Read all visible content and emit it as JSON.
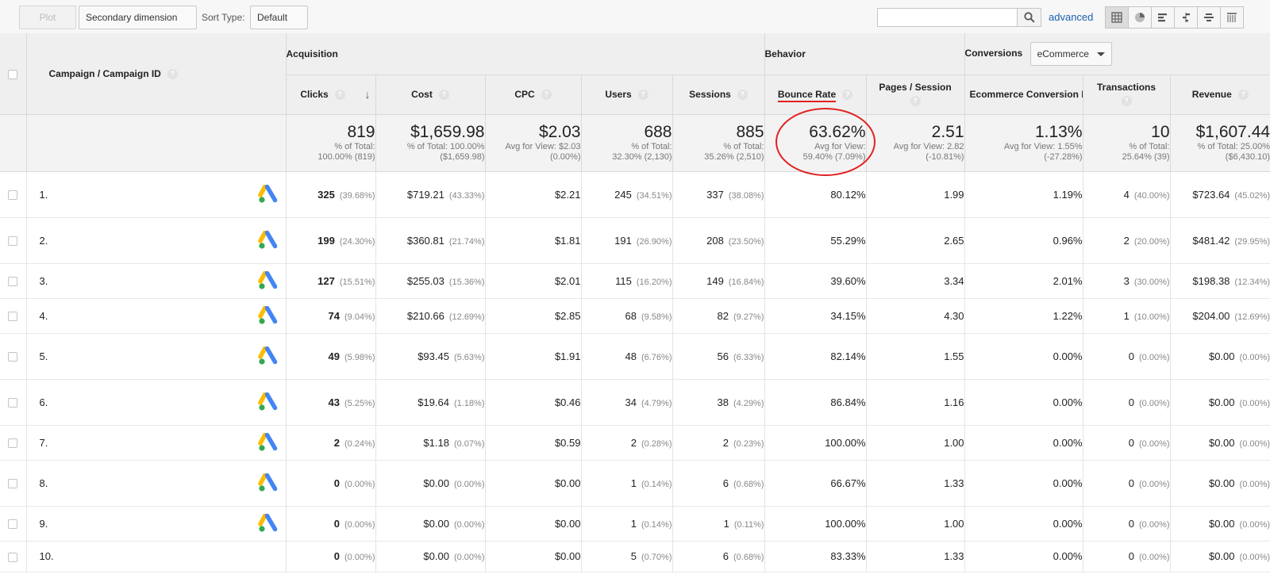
{
  "toolbar": {
    "plot_rows": "Plot Rows",
    "secondary_dimension": "Secondary dimension",
    "sort_type_label": "Sort Type:",
    "sort_type_value": "Default",
    "search_value": "",
    "advanced": "advanced",
    "view_icons": [
      "table-view-icon",
      "pie-view-icon",
      "performance-view-icon",
      "comparison-view-icon",
      "term-cloud-view-icon",
      "pivot-view-icon"
    ]
  },
  "groups": {
    "acquisition": "Acquisition",
    "behavior": "Behavior",
    "conversions": "Conversions",
    "conversions_select": "eCommerce"
  },
  "columns": {
    "dimension": "Campaign / Campaign ID",
    "clicks": "Clicks",
    "cost": "Cost",
    "cpc": "CPC",
    "users": "Users",
    "sessions": "Sessions",
    "bounce_rate": "Bounce Rate",
    "pages_session": "Pages / Session",
    "ecom_rate": "Ecommerce Conversion Rate",
    "transactions": "Transactions",
    "revenue": "Revenue"
  },
  "totals": {
    "clicks": {
      "value": "819",
      "sub1": "% of Total:",
      "sub2": "100.00% (819)"
    },
    "cost": {
      "value": "$1,659.98",
      "sub1": "% of Total: 100.00%",
      "sub2": "($1,659.98)"
    },
    "cpc": {
      "value": "$2.03",
      "sub1": "Avg for View: $2.03",
      "sub2": "(0.00%)"
    },
    "users": {
      "value": "688",
      "sub1": "% of Total:",
      "sub2": "32.30% (2,130)"
    },
    "sessions": {
      "value": "885",
      "sub1": "% of Total:",
      "sub2": "35.26% (2,510)"
    },
    "bounce_rate": {
      "value": "63.62%",
      "sub1": "Avg for View:",
      "sub2": "59.40% (7.09%)"
    },
    "pages_session": {
      "value": "2.51",
      "sub1": "Avg for View: 2.82",
      "sub2": "(-10.81%)"
    },
    "ecom_rate": {
      "value": "1.13%",
      "sub1": "Avg for View: 1.55%",
      "sub2": "(-27.28%)"
    },
    "transactions": {
      "value": "10",
      "sub1": "% of Total:",
      "sub2": "25.64% (39)"
    },
    "revenue": {
      "value": "$1,607.44",
      "sub1": "% of Total: 25.00%",
      "sub2": "($6,430.10)"
    }
  },
  "rows": [
    {
      "idx": "1.",
      "clicks": "325",
      "clicks_pct": "(39.68%)",
      "cost": "$719.21",
      "cost_pct": "(43.33%)",
      "cpc": "$2.21",
      "users": "245",
      "users_pct": "(34.51%)",
      "sessions": "337",
      "sessions_pct": "(38.08%)",
      "bounce": "80.12%",
      "pages": "1.99",
      "ecom": "1.19%",
      "trans": "4",
      "trans_pct": "(40.00%)",
      "revenue": "$723.64",
      "revenue_pct": "(45.02%)"
    },
    {
      "idx": "2.",
      "clicks": "199",
      "clicks_pct": "(24.30%)",
      "cost": "$360.81",
      "cost_pct": "(21.74%)",
      "cpc": "$1.81",
      "users": "191",
      "users_pct": "(26.90%)",
      "sessions": "208",
      "sessions_pct": "(23.50%)",
      "bounce": "55.29%",
      "pages": "2.65",
      "ecom": "0.96%",
      "trans": "2",
      "trans_pct": "(20.00%)",
      "revenue": "$481.42",
      "revenue_pct": "(29.95%)"
    },
    {
      "idx": "3.",
      "clicks": "127",
      "clicks_pct": "(15.51%)",
      "cost": "$255.03",
      "cost_pct": "(15.36%)",
      "cpc": "$2.01",
      "users": "115",
      "users_pct": "(16.20%)",
      "sessions": "149",
      "sessions_pct": "(16.84%)",
      "bounce": "39.60%",
      "pages": "3.34",
      "ecom": "2.01%",
      "trans": "3",
      "trans_pct": "(30.00%)",
      "revenue": "$198.38",
      "revenue_pct": "(12.34%)"
    },
    {
      "idx": "4.",
      "clicks": "74",
      "clicks_pct": "(9.04%)",
      "cost": "$210.66",
      "cost_pct": "(12.69%)",
      "cpc": "$2.85",
      "users": "68",
      "users_pct": "(9.58%)",
      "sessions": "82",
      "sessions_pct": "(9.27%)",
      "bounce": "34.15%",
      "pages": "4.30",
      "ecom": "1.22%",
      "trans": "1",
      "trans_pct": "(10.00%)",
      "revenue": "$204.00",
      "revenue_pct": "(12.69%)"
    },
    {
      "idx": "5.",
      "clicks": "49",
      "clicks_pct": "(5.98%)",
      "cost": "$93.45",
      "cost_pct": "(5.63%)",
      "cpc": "$1.91",
      "users": "48",
      "users_pct": "(6.76%)",
      "sessions": "56",
      "sessions_pct": "(6.33%)",
      "bounce": "82.14%",
      "pages": "1.55",
      "ecom": "0.00%",
      "trans": "0",
      "trans_pct": "(0.00%)",
      "revenue": "$0.00",
      "revenue_pct": "(0.00%)"
    },
    {
      "idx": "6.",
      "clicks": "43",
      "clicks_pct": "(5.25%)",
      "cost": "$19.64",
      "cost_pct": "(1.18%)",
      "cpc": "$0.46",
      "users": "34",
      "users_pct": "(4.79%)",
      "sessions": "38",
      "sessions_pct": "(4.29%)",
      "bounce": "86.84%",
      "pages": "1.16",
      "ecom": "0.00%",
      "trans": "0",
      "trans_pct": "(0.00%)",
      "revenue": "$0.00",
      "revenue_pct": "(0.00%)"
    },
    {
      "idx": "7.",
      "clicks": "2",
      "clicks_pct": "(0.24%)",
      "cost": "$1.18",
      "cost_pct": "(0.07%)",
      "cpc": "$0.59",
      "users": "2",
      "users_pct": "(0.28%)",
      "sessions": "2",
      "sessions_pct": "(0.23%)",
      "bounce": "100.00%",
      "pages": "1.00",
      "ecom": "0.00%",
      "trans": "0",
      "trans_pct": "(0.00%)",
      "revenue": "$0.00",
      "revenue_pct": "(0.00%)"
    },
    {
      "idx": "8.",
      "clicks": "0",
      "clicks_pct": "(0.00%)",
      "cost": "$0.00",
      "cost_pct": "(0.00%)",
      "cpc": "$0.00",
      "users": "1",
      "users_pct": "(0.14%)",
      "sessions": "6",
      "sessions_pct": "(0.68%)",
      "bounce": "66.67%",
      "pages": "1.33",
      "ecom": "0.00%",
      "trans": "0",
      "trans_pct": "(0.00%)",
      "revenue": "$0.00",
      "revenue_pct": "(0.00%)"
    },
    {
      "idx": "9.",
      "clicks": "0",
      "clicks_pct": "(0.00%)",
      "cost": "$0.00",
      "cost_pct": "(0.00%)",
      "cpc": "$0.00",
      "users": "1",
      "users_pct": "(0.14%)",
      "sessions": "1",
      "sessions_pct": "(0.11%)",
      "bounce": "100.00%",
      "pages": "1.00",
      "ecom": "0.00%",
      "trans": "0",
      "trans_pct": "(0.00%)",
      "revenue": "$0.00",
      "revenue_pct": "(0.00%)"
    },
    {
      "idx": "10.",
      "clicks": "0",
      "clicks_pct": "(0.00%)",
      "cost": "$0.00",
      "cost_pct": "(0.00%)",
      "cpc": "$0.00",
      "users": "5",
      "users_pct": "(0.70%)",
      "sessions": "6",
      "sessions_pct": "(0.68%)",
      "bounce": "83.33%",
      "pages": "1.33",
      "ecom": "0.00%",
      "trans": "0",
      "trans_pct": "(0.00%)",
      "revenue": "$0.00",
      "revenue_pct": "(0.00%)"
    }
  ],
  "colors": {
    "highlight_red": "#e21f1f",
    "link_blue": "#1a5fb4",
    "ads_yellow": "#fbbc04",
    "ads_blue": "#4285f4",
    "ads_green": "#34a853"
  }
}
